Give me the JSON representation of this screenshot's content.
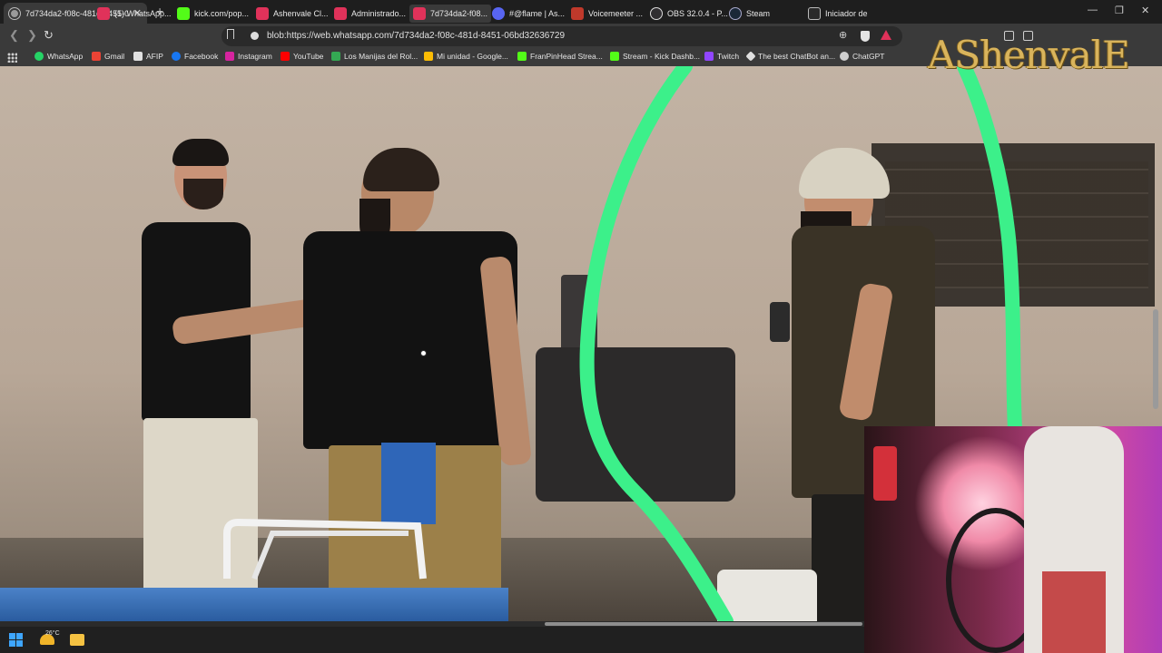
{
  "browser": {
    "tab_title": "7d734da2-f08c-481d-8451-06bd32636729",
    "new_tab_icon": "plus-icon",
    "url": "blob:https://web.whatsapp.com/7d734da2-f08c-481d-8451-06bd32636729"
  },
  "bookmarks": [
    {
      "label": "WhatsApp",
      "color": "#25d366"
    },
    {
      "label": "Gmail",
      "color": "#ea4335"
    },
    {
      "label": "AFIP",
      "color": "#e0e0e0"
    },
    {
      "label": "Facebook",
      "color": "#1877f2"
    },
    {
      "label": "Instagram",
      "color": "#d6249f"
    },
    {
      "label": "YouTube",
      "color": "#ff0000"
    },
    {
      "label": "Los Manijas del Rol...",
      "color": "#34a853"
    },
    {
      "label": "Mi unidad - Google...",
      "color": "#fbbc04"
    },
    {
      "label": "FranPinHead Strea...",
      "color": "#53fc18"
    },
    {
      "label": "Stream - Kick Dashb...",
      "color": "#53fc18"
    },
    {
      "label": "Twitch",
      "color": "#9146ff"
    },
    {
      "label": "The best ChatBot an...",
      "color": "#e0e0e0"
    },
    {
      "label": "ChatGPT",
      "color": "#cfcfcf"
    }
  ],
  "overlay": {
    "logo_text": "AShenvalE"
  },
  "taskbar": {
    "temperature": "26°C",
    "items": [
      {
        "label": "(5) WhatsApp...",
        "color": "#e0325a"
      },
      {
        "label": "kick.com/pop...",
        "color": "#53fc18"
      },
      {
        "label": "Ashenvale Cl...",
        "color": "#e0325a"
      },
      {
        "label": "Administrado...",
        "color": "#e0325a"
      },
      {
        "label": "7d734da2-f08...",
        "color": "#e0325a"
      },
      {
        "label": "#@flame | As...",
        "color": "#5865f2"
      },
      {
        "label": "Voicemeeter ...",
        "color": "#c0392b"
      },
      {
        "label": "OBS 32.0.4 - P...",
        "color": "#302e31"
      },
      {
        "label": "Steam",
        "color": "#1b2838"
      },
      {
        "label": "Iniciador de",
        "color": "#2a2a2a"
      }
    ]
  }
}
